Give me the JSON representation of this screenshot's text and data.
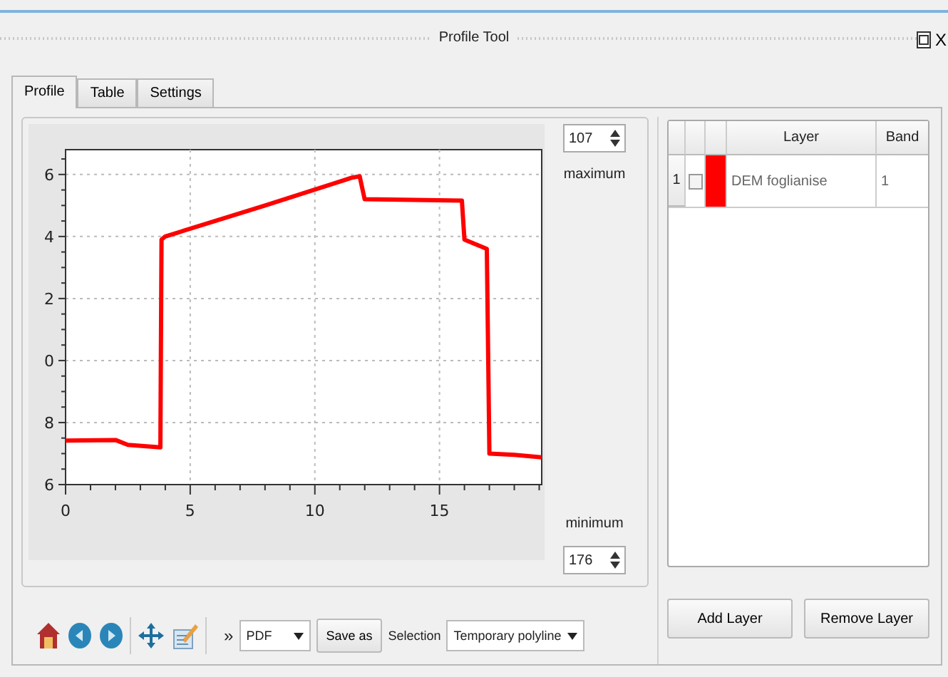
{
  "window": {
    "title": "Profile Tool",
    "close_label": "X"
  },
  "tabs": [
    {
      "label": "Profile",
      "selected": true
    },
    {
      "label": "Table",
      "selected": false
    },
    {
      "label": "Settings",
      "selected": false
    }
  ],
  "profile_plot": {
    "x_labels": [
      "0",
      "5",
      "10",
      "15"
    ],
    "y_labels": [
      "6",
      "4",
      "2",
      "0",
      "8",
      "6"
    ]
  },
  "maximum": {
    "value": "107",
    "label": "maximum"
  },
  "minimum": {
    "label": "minimum",
    "value": "176"
  },
  "toolbar": {
    "more": "»",
    "format": "PDF",
    "save": "Save as",
    "selection_label": "Selection",
    "selection": "Temporary polyline"
  },
  "layers": {
    "columns": [
      "Layer",
      "Band"
    ],
    "rows": [
      {
        "index": "1",
        "checked": false,
        "color": "#ff0000",
        "layer": "DEM foglianise",
        "band": "1"
      }
    ]
  },
  "buttons": [
    "Add Layer",
    "Remove Layer"
  ]
}
